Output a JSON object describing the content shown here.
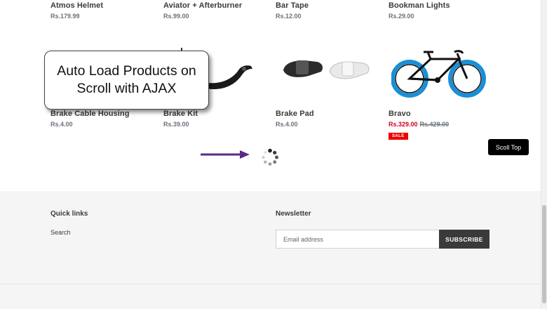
{
  "products": [
    {
      "title": "Atmos Helmet",
      "price": "Rs.179.99"
    },
    {
      "title": "Aviator + Afterburner",
      "price": "Rs.99.00"
    },
    {
      "title": "Bar Tape",
      "price": "Rs.12.00"
    },
    {
      "title": "Bookman Lights",
      "price": "Rs.29.00"
    },
    {
      "title": "Brake Cable Housing",
      "price": "Rs.4.00"
    },
    {
      "title": "Brake Kit",
      "price": "Rs.39.00"
    },
    {
      "title": "Brake Pad",
      "price": "Rs.4.00"
    },
    {
      "title": "Bravo",
      "sale_price": "Rs.329.00",
      "compare_price": "Rs.429.00",
      "badge": "SALE"
    }
  ],
  "callout": {
    "text": "Auto Load Products on Scroll with AJAX"
  },
  "scroll_top": {
    "label": "Scoll Top"
  },
  "footer": {
    "quick_links_heading": "Quick links",
    "search_link": "Search",
    "newsletter_heading": "Newsletter",
    "email_placeholder": "Email address",
    "subscribe_label": "SUBSCRIBE"
  },
  "colors": {
    "sale": "#d0021b",
    "arrow": "#5b2a86",
    "button_dark": "#3a3a3a"
  }
}
